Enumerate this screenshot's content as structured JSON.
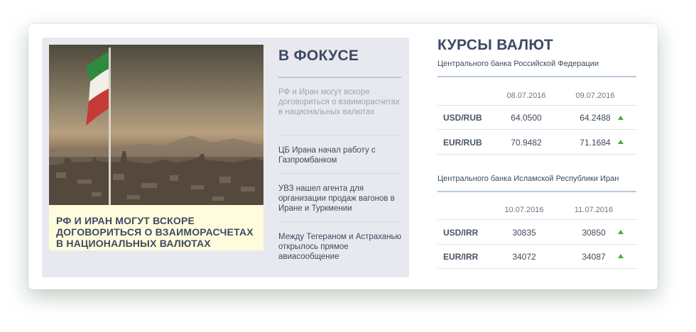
{
  "focus": {
    "heading": "В ФОКУСЕ",
    "featured_caption": "РФ И ИРАН МОГУТ ВСКОРЕ ДОГОВОРИТЬСЯ О ВЗАИМОРАСЧЕТАХ В НАЦИОНАЛЬНЫХ ВАЛЮТАХ",
    "news": [
      {
        "title": "РФ и Иран могут вскоре договориться о взаиморасчетах в национальных валютах",
        "active": true
      },
      {
        "title": "ЦБ Ирана начал работу с Газпромбанком",
        "active": false
      },
      {
        "title": "УВЗ нашел агента для организации продаж вагонов в Иране и Туркмении",
        "active": false
      },
      {
        "title": "Между Тегераном и Астраханью открылось прямое авиасообщение",
        "active": false
      }
    ]
  },
  "rates": {
    "title": "КУРСЫ ВАЛЮТ",
    "colors": {
      "accent": "#3d4a63",
      "up": "#3fb12c",
      "divider": "#b9cadb"
    },
    "blocks": [
      {
        "source": "Центрального банка Российской Федерации",
        "dates": [
          "08.07.2016",
          "09.07.2016"
        ],
        "rows": [
          {
            "pair": "USD/RUB",
            "values": [
              "64.0500",
              "64.2488"
            ],
            "trend": "up"
          },
          {
            "pair": "EUR/RUB",
            "values": [
              "70.9482",
              "71.1684"
            ],
            "trend": "up"
          }
        ]
      },
      {
        "source": "Центрального банка Исламской Республики Иран",
        "dates": [
          "10.07.2016",
          "11.07.2016"
        ],
        "rows": [
          {
            "pair": "USD/IRR",
            "values": [
              "30835",
              "30850"
            ],
            "trend": "up"
          },
          {
            "pair": "EUR/IRR",
            "values": [
              "34072",
              "34087"
            ],
            "trend": "up"
          }
        ]
      }
    ]
  }
}
